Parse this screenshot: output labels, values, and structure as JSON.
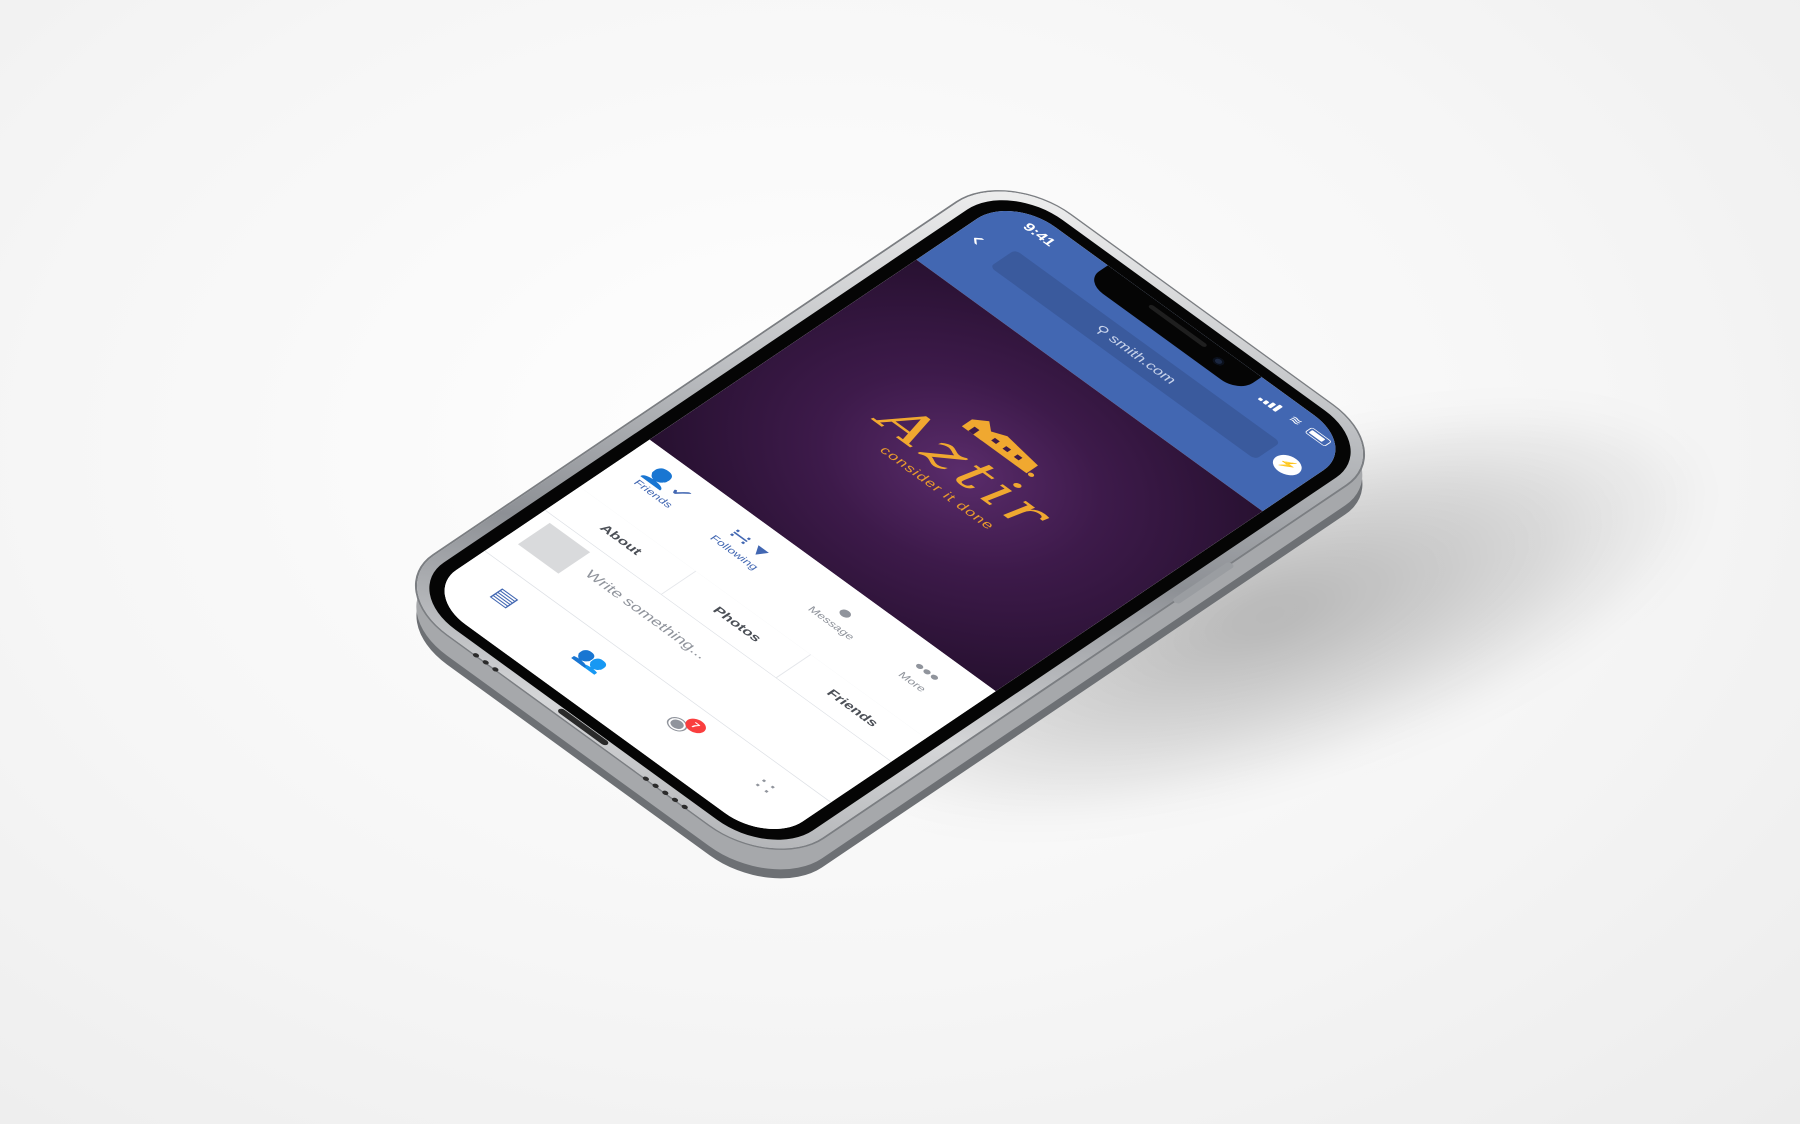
{
  "status_bar": {
    "time": "9:41"
  },
  "browser": {
    "back_icon": "chevron-left-icon",
    "search_text": "smith.com",
    "messenger_icon": "messenger-icon"
  },
  "cover": {
    "brand": "Aztir",
    "tagline": "consider it done",
    "logo_color": "#f0a830"
  },
  "actions": [
    {
      "label": "Friends",
      "icon": "friends-check-icon"
    },
    {
      "label": "Following",
      "icon": "following-feed-icon"
    },
    {
      "label": "Message",
      "icon": "messenger-icon"
    },
    {
      "label": "More",
      "icon": "more-dots-icon"
    }
  ],
  "tabs": [
    {
      "label": "About"
    },
    {
      "label": "Photos"
    },
    {
      "label": "Friends"
    }
  ],
  "composer": {
    "placeholder": "Write something..."
  },
  "tab_bar": {
    "items": [
      {
        "icon": "news-feed-icon"
      },
      {
        "icon": "friends-icon"
      },
      {
        "icon": "notifications-icon",
        "badge": "7"
      },
      {
        "icon": "menu-grid-icon"
      }
    ]
  },
  "colors": {
    "facebook_blue": "#4267b2",
    "cover_purple": "#3d1a4a",
    "badge_red": "#fa3e3e"
  }
}
